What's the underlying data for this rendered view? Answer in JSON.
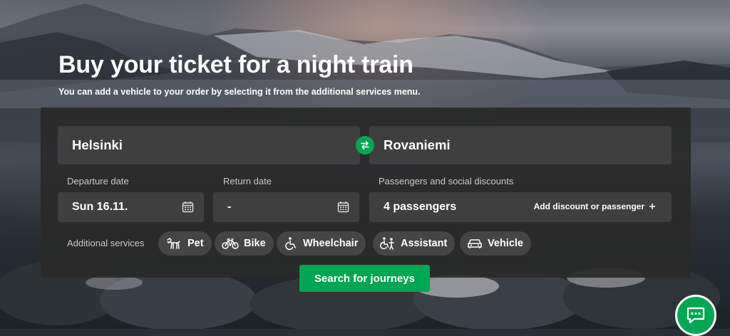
{
  "hero": {
    "title": "Buy your ticket for a night train",
    "subtitle": "You can add a vehicle to your order by selecting it from the additional services menu."
  },
  "search_form": {
    "from": "Helsinki",
    "to": "Rovaniemi",
    "departure_label": "Departure date",
    "departure_value": "Sun 16.11.",
    "return_label": "Return date",
    "return_value": "-",
    "passengers_label": "Passengers and social discounts",
    "passengers_value": "4 passengers",
    "add_discount_label": "Add discount or passenger",
    "additional_services_label": "Additional services",
    "services": [
      {
        "label": "Pet",
        "icon": "dog-icon"
      },
      {
        "label": "Bike",
        "icon": "bike-icon"
      },
      {
        "label": "Wheelchair",
        "icon": "wheelchair-icon"
      },
      {
        "label": "Assistant",
        "icon": "assistant-icon"
      },
      {
        "label": "Vehicle",
        "icon": "car-icon"
      }
    ],
    "search_button": "Search for journeys"
  },
  "colors": {
    "accent": "#00a651",
    "panel": "#2a2a2a",
    "field": "#3f3f3f"
  }
}
